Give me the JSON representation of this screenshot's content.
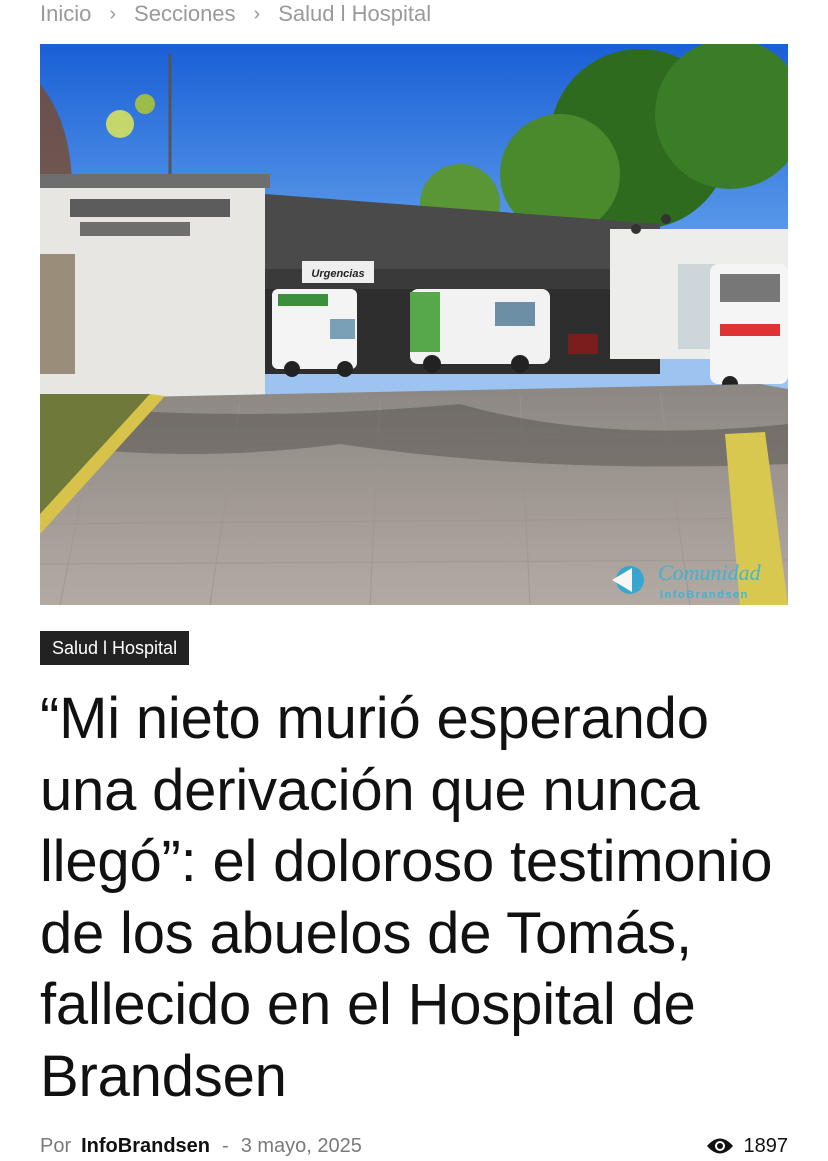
{
  "breadcrumb": {
    "items": [
      "Inicio",
      "Secciones",
      "Salud l Hospital"
    ],
    "separator": "›"
  },
  "hero": {
    "sign_text": "Urgencias",
    "watermark_line1": "Comunidad",
    "watermark_line2": "InfoBrandsen"
  },
  "article": {
    "category": "Salud l Hospital",
    "title": "“Mi nieto murió esperando una derivación que nunca llegó”: el doloroso testimonio de los abuelos de Tomás, fallecido en el Hospital de Brandsen",
    "by_label": "Por",
    "author": "InfoBrandsen",
    "date_separator": "-",
    "date": "3 mayo, 2025",
    "views": "1897"
  },
  "icons": {
    "views": "eye-icon",
    "breadcrumb_separator": "chevron-right-icon",
    "watermark": "megaphone-icon"
  },
  "colors": {
    "tag_bg": "#222222",
    "muted_text": "#9a9a9a",
    "title_text": "#111111"
  }
}
